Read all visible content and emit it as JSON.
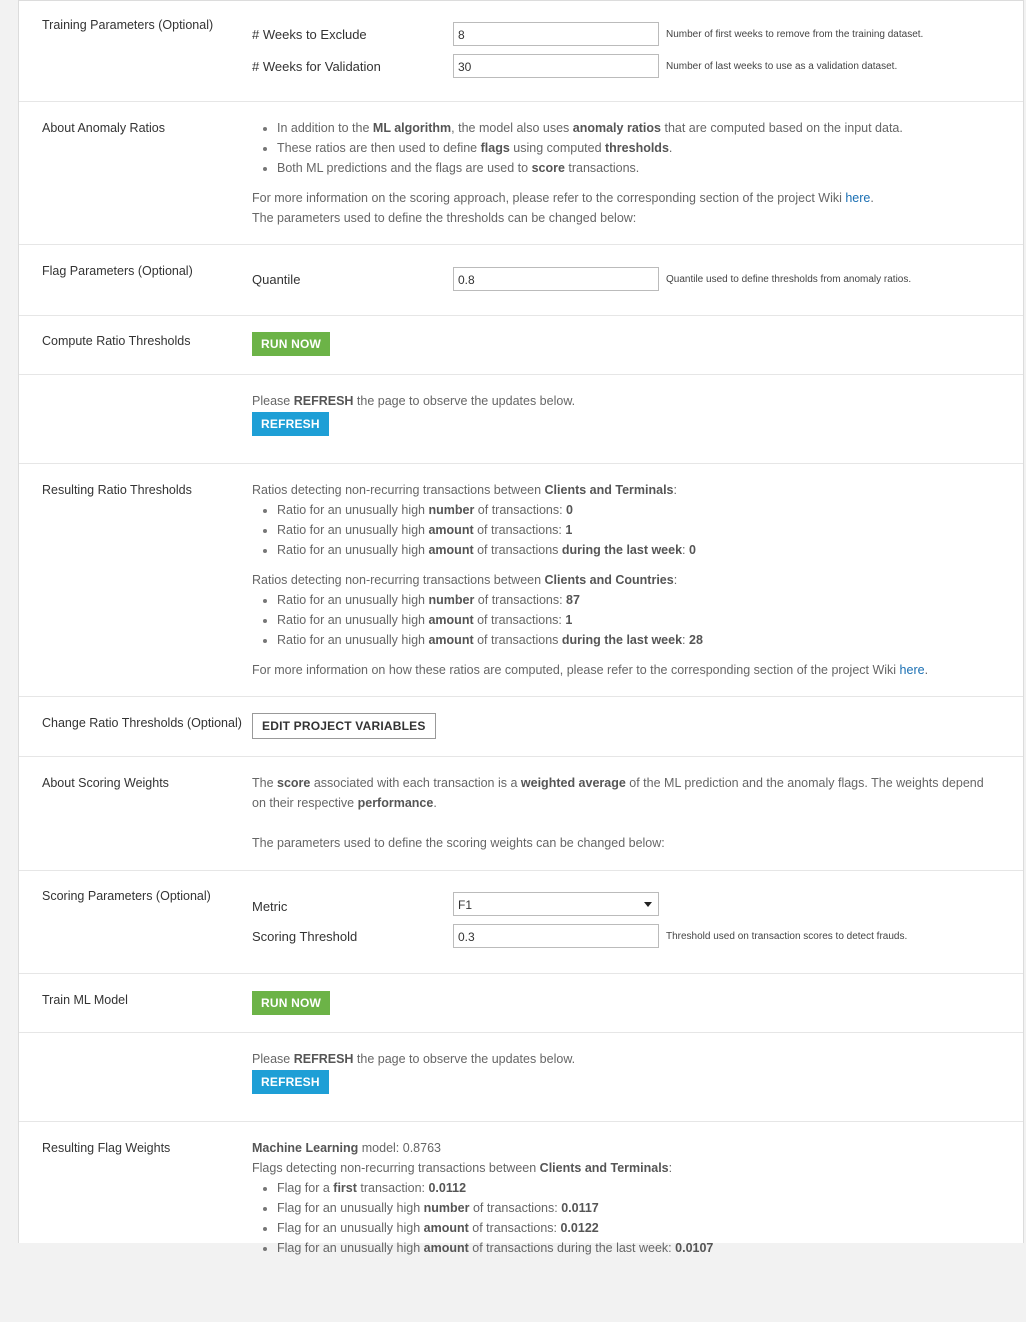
{
  "sections": {
    "training": {
      "label": "Training Parameters (Optional)",
      "fields": [
        {
          "label": "# Weeks to Exclude",
          "value": "8",
          "hint": "Number of first weeks to remove from the training dataset."
        },
        {
          "label": "# Weeks for Validation",
          "value": "30",
          "hint": "Number of last weeks to use as a validation dataset."
        }
      ]
    },
    "about_ratios": {
      "label": "About Anomaly Ratios",
      "bullets": [
        {
          "pre": "In addition to the ",
          "b1": "ML algorithm",
          "mid": ", the model also uses ",
          "b2": "anomaly ratios",
          "post": " that are computed based on the input data."
        },
        {
          "pre": "These ratios are then used to define ",
          "b1": "flags",
          "mid": " using computed ",
          "b2": "thresholds",
          "post": "."
        },
        {
          "pre": "Both ML predictions and the flags are used to ",
          "b1": "score",
          "mid": " transactions.",
          "b2": "",
          "post": ""
        }
      ],
      "info_pre": "For more information on the scoring approach, please refer to the corresponding section of the project Wiki ",
      "info_link": "here",
      "info_post": ".",
      "params_note": "The parameters used to define the thresholds can be changed below:"
    },
    "flag_params": {
      "label": "Flag Parameters (Optional)",
      "field": {
        "label": "Quantile",
        "value": "0.8",
        "hint": "Quantile used to define thresholds from anomaly ratios."
      }
    },
    "compute_thresholds": {
      "label": "Compute Ratio Thresholds",
      "button": "RUN NOW"
    },
    "refresh1": {
      "pre": "Please ",
      "bold": "REFRESH",
      "post": " the page to observe the updates below.",
      "button": "REFRESH"
    },
    "resulting_thresholds": {
      "label": "Resulting Ratio Thresholds",
      "groups": [
        {
          "intro_pre": "Ratios detecting non-recurring transactions between ",
          "intro_bold": "Clients and Terminals",
          "intro_post": ":",
          "items": [
            {
              "pre": "Ratio for an unusually high ",
              "b": "number",
              "mid": " of transactions: ",
              "b2": "",
              "value": "0"
            },
            {
              "pre": "Ratio for an unusually high ",
              "b": "amount",
              "mid": " of transactions: ",
              "b2": "",
              "value": "1"
            },
            {
              "pre": "Ratio for an unusually high ",
              "b": "amount",
              "mid": " of transactions ",
              "b2": "during the last week",
              "value": "0"
            }
          ]
        },
        {
          "intro_pre": "Ratios detecting non-recurring transactions between ",
          "intro_bold": "Clients and Countries",
          "intro_post": ":",
          "items": [
            {
              "pre": "Ratio for an unusually high ",
              "b": "number",
              "mid": " of transactions: ",
              "b2": "",
              "value": "87"
            },
            {
              "pre": "Ratio for an unusually high ",
              "b": "amount",
              "mid": " of transactions: ",
              "b2": "",
              "value": "1"
            },
            {
              "pre": "Ratio for an unusually high ",
              "b": "amount",
              "mid": " of transactions ",
              "b2": "during the last week",
              "value": "28"
            }
          ]
        }
      ],
      "info_pre": "For more information on how these ratios are computed, please refer to the corresponding section of the project Wiki ",
      "info_link": "here",
      "info_post": "."
    },
    "change_thresholds": {
      "label": "Change Ratio Thresholds (Optional)",
      "button": "EDIT PROJECT VARIABLES"
    },
    "about_weights": {
      "label": "About Scoring Weights",
      "t1": "The ",
      "b1": "score",
      "t2": " associated with each transaction is a ",
      "b2": "weighted average",
      "t3": " of the ML prediction and the anomaly flags. The weights depend on their respective ",
      "b3": "performance",
      "t4": ".",
      "params_note": "The parameters used to define the scoring weights can be changed below:"
    },
    "scoring_params": {
      "label": "Scoring Parameters (Optional)",
      "metric": {
        "label": "Metric",
        "value": "F1"
      },
      "threshold": {
        "label": "Scoring Threshold",
        "value": "0.3",
        "hint": "Threshold used on transaction scores to detect frauds."
      }
    },
    "train_model": {
      "label": "Train ML Model",
      "button": "RUN NOW"
    },
    "refresh2": {
      "pre": "Please ",
      "bold": "REFRESH",
      "post": " the page to observe the updates below.",
      "button": "REFRESH"
    },
    "flag_weights": {
      "label": "Resulting Flag Weights",
      "ml_bold": "Machine Learning",
      "ml_post": " model: 0.8763",
      "intro_pre": "Flags detecting non-recurring transactions between ",
      "intro_bold": "Clients and Terminals",
      "intro_post": ":",
      "items": [
        {
          "pre": "Flag for a ",
          "b": "first",
          "mid": " transaction: ",
          "value": "0.0112"
        },
        {
          "pre": "Flag for an unusually high ",
          "b": "number",
          "mid": " of transactions: ",
          "value": "0.0117"
        },
        {
          "pre": "Flag for an unusually high ",
          "b": "amount",
          "mid": " of transactions: ",
          "value": "0.0122"
        },
        {
          "pre": "Flag for an unusually high ",
          "b": "amount",
          "mid": " of transactions during the last week: ",
          "value": "0.0107"
        }
      ]
    }
  },
  "colors": {
    "run_button": "#6cb347",
    "refresh_button": "#1e9fd6",
    "link": "#1a6fb3"
  }
}
